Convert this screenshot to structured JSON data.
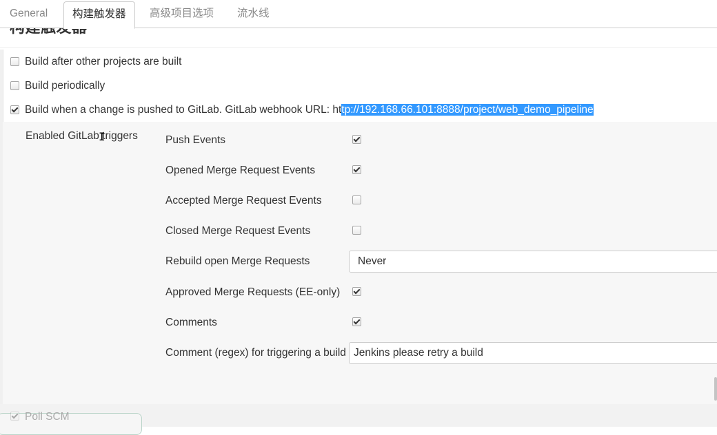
{
  "tabs": [
    {
      "label": "General",
      "active": false
    },
    {
      "label": "构建触发器",
      "active": true
    },
    {
      "label": "高级项目选项",
      "active": false
    },
    {
      "label": "流水线",
      "active": false
    }
  ],
  "section": {
    "heading": "构建触发器"
  },
  "triggers": {
    "build_after": {
      "label": "Build after other projects are built",
      "checked": false
    },
    "build_periodically": {
      "label": "Build periodically",
      "checked": false
    },
    "gitlab": {
      "label_prefix": "Build when a change is pushed to GitLab. GitLab webhook URL: ht",
      "url_selected": "tp://192.168.66.101:8888/project/web_demo_pipeline",
      "checked": true
    }
  },
  "gitlab_options": {
    "group_label": "Enabled GitLab triggers",
    "push_events": {
      "label": "Push Events",
      "checked": true
    },
    "opened_mr": {
      "label": "Opened Merge Request Events",
      "checked": true
    },
    "accepted_mr": {
      "label": "Accepted Merge Request Events",
      "checked": false
    },
    "closed_mr": {
      "label": "Closed Merge Request Events",
      "checked": false
    },
    "rebuild_open_mr": {
      "label": "Rebuild open Merge Requests",
      "value": "Never"
    },
    "approved_mr": {
      "label": "Approved Merge Requests (EE-only)",
      "checked": true
    },
    "comments": {
      "label": "Comments",
      "checked": true
    },
    "comment_regex": {
      "label": "Comment (regex) for triggering a build",
      "value": "Jenkins please retry a build"
    }
  },
  "poll_scm": {
    "label": "Poll SCM",
    "checked": true
  }
}
